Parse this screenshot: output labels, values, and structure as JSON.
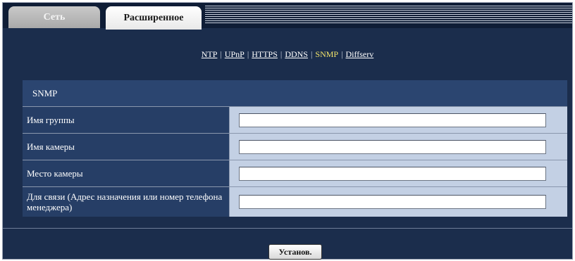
{
  "tabs": [
    {
      "label": "Сеть",
      "active": false
    },
    {
      "label": "Расширенное",
      "active": true
    }
  ],
  "subnav": {
    "items": [
      {
        "label": "NTP",
        "active": false
      },
      {
        "label": "UPnP",
        "active": false
      },
      {
        "label": "HTTPS",
        "active": false
      },
      {
        "label": "DDNS",
        "active": false
      },
      {
        "label": "SNMP",
        "active": true
      },
      {
        "label": "Diffserv",
        "active": false
      }
    ],
    "separator": "|"
  },
  "panel": {
    "title": "SNMP",
    "fields": [
      {
        "label": "Имя группы",
        "value": ""
      },
      {
        "label": "Имя камеры",
        "value": ""
      },
      {
        "label": "Место камеры",
        "value": ""
      },
      {
        "label": "Для связи (Адрес назначения или номер телефона менеджера)",
        "value": ""
      }
    ]
  },
  "actions": {
    "set_label": "Установ."
  },
  "colors": {
    "background": "#1b2d4c",
    "row_label_bg": "#263e66",
    "row_field_bg": "#c3d0e4",
    "active_link": "#f0e26a"
  }
}
